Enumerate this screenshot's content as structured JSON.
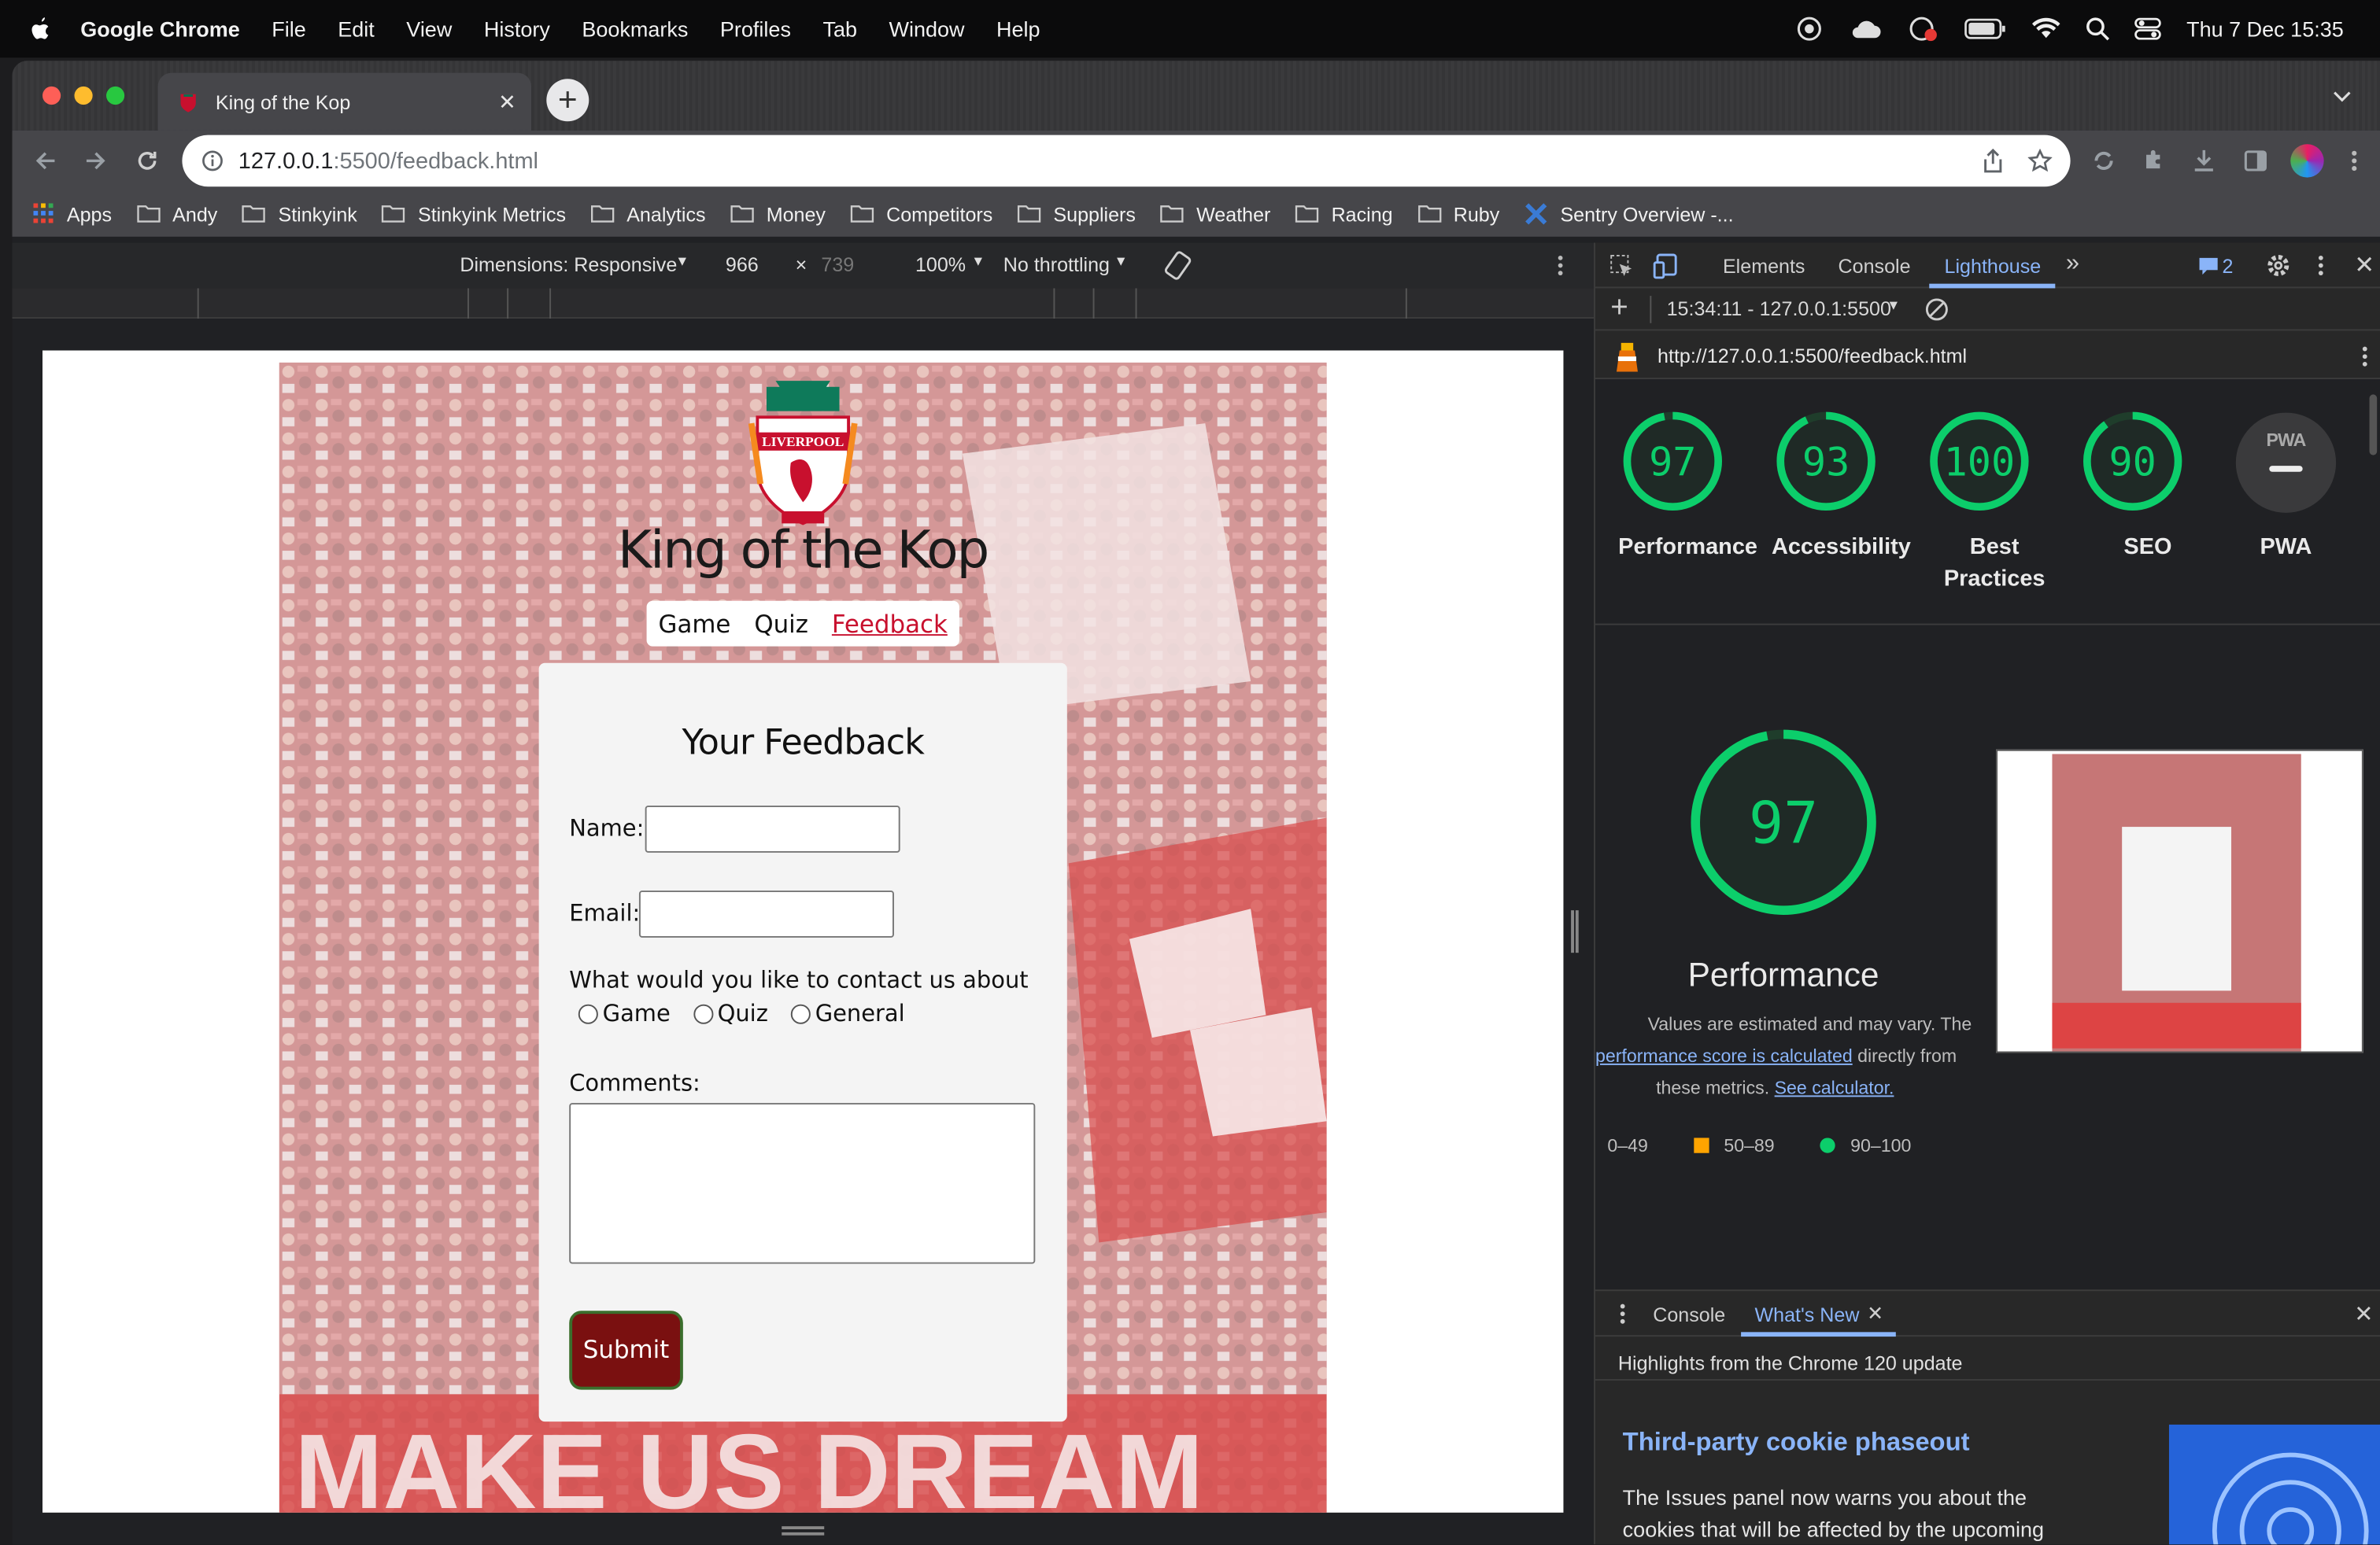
{
  "menubar": {
    "app": "Google Chrome",
    "items": [
      "File",
      "Edit",
      "View",
      "History",
      "Bookmarks",
      "Profiles",
      "Tab",
      "Window",
      "Help"
    ],
    "clock": "Thu 7 Dec  15:35"
  },
  "browser": {
    "tab_title": "King of the Kop",
    "url_host": "127.0.0.1",
    "url_path": ":5500/feedback.html",
    "bookmarks": [
      "Apps",
      "Andy",
      "Stinkyink",
      "Stinkyink Metrics",
      "Analytics",
      "Money",
      "Competitors",
      "Suppliers",
      "Weather",
      "Racing",
      "Ruby",
      "Sentry Overview -..."
    ]
  },
  "emulation": {
    "dimensions": "Dimensions: Responsive",
    "width": "966",
    "times": "×",
    "height": "739",
    "zoom": "100%",
    "throttle": "No throttling"
  },
  "site": {
    "crest_text": "LIVERPOOL",
    "title": "King of the Kop",
    "nav": [
      "Game",
      "Quiz",
      "Feedback"
    ],
    "form": {
      "heading": "Your Feedback",
      "name_label": "Name:",
      "email_label": "Email:",
      "contact_label": "What would you like to contact us about",
      "options": [
        "Game",
        "Quiz",
        "General"
      ],
      "comments_label": "Comments:",
      "submit": "Submit"
    },
    "banner_text": "MAKE US DREAM"
  },
  "devtools": {
    "tabs": [
      "Elements",
      "Console",
      "Lighthouse"
    ],
    "issues_count": "2",
    "report_time": "15:34:11 - 127.0.0.1:5500",
    "report_url": "http://127.0.0.1:5500/feedback.html",
    "scores": [
      {
        "value": "97",
        "label": "Performance",
        "fraction": 0.97
      },
      {
        "value": "93",
        "label": "Accessibility",
        "fraction": 0.93
      },
      {
        "value": "100",
        "label": "Best Practices",
        "fraction": 1.0
      },
      {
        "value": "90",
        "label": "SEO",
        "fraction": 0.9
      }
    ],
    "pwa_label": "PWA",
    "pwa_badge": "PWA",
    "main_score": "97",
    "main_label": "Performance",
    "note_1": "Values are estimated and may vary. The",
    "note_link": "performance score is calculated",
    "note_2": "directly from",
    "note_3": "these metrics.",
    "note_link2": "See calculator.",
    "legend": [
      "0–49",
      "50–89",
      "90–100"
    ],
    "drawer_tabs": [
      "Console",
      "What's New"
    ],
    "drawer_subtitle": "Highlights from the Chrome 120 update",
    "news_title": "Third-party cookie phaseout",
    "news_body": "The Issues panel now warns you about the cookies that will be affected by the upcoming deprecation and phaseout of third-party cookies."
  },
  "colors": {
    "good": "#0cce6b",
    "average": "#ffa400",
    "accent": "#8ab4f8",
    "submit": "#7a1010"
  }
}
